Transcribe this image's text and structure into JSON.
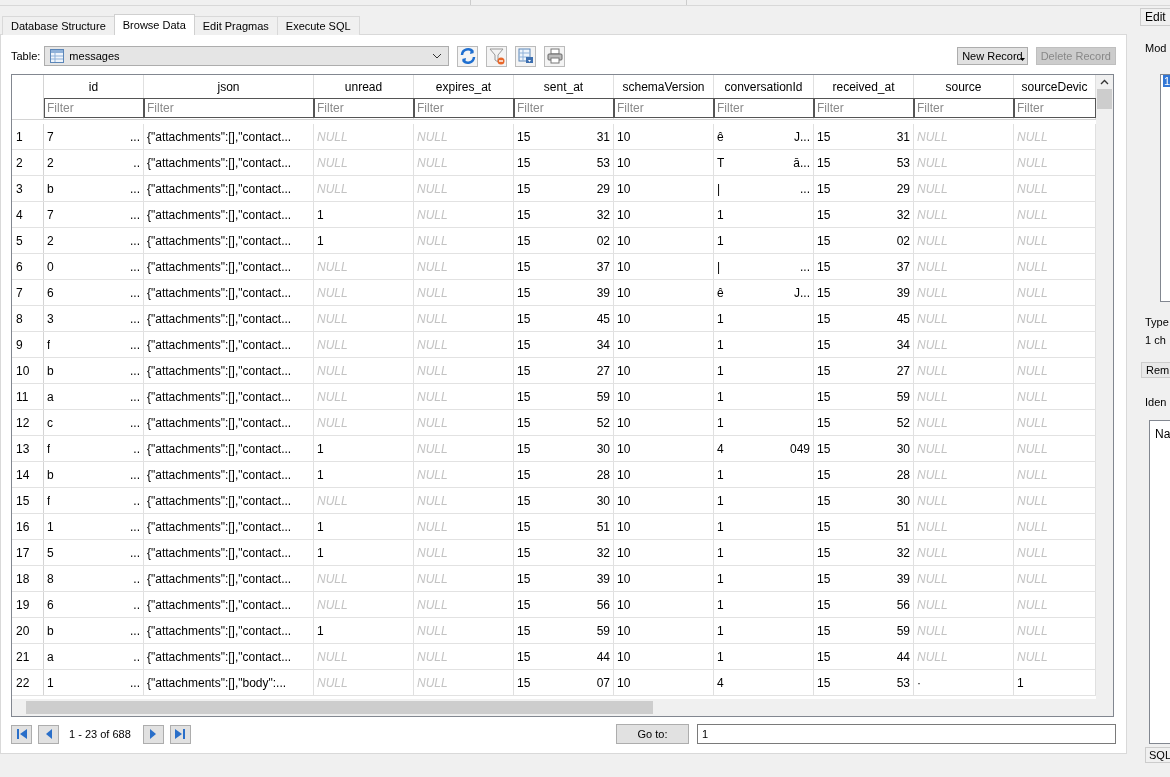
{
  "tabs": [
    {
      "label": "Database Structure",
      "selected": false
    },
    {
      "label": "Browse Data",
      "selected": true
    },
    {
      "label": "Edit Pragmas",
      "selected": false
    },
    {
      "label": "Execute SQL",
      "selected": false
    }
  ],
  "table_picker": {
    "label": "Table:",
    "value": "messages"
  },
  "toolbar": {
    "new_record": {
      "label": "New Record",
      "disabled": false
    },
    "delete_record": {
      "label": "Delete Record",
      "disabled": true
    }
  },
  "table": {
    "columns": [
      {
        "label": "id",
        "filter_placeholder": "Filter"
      },
      {
        "label": "json",
        "filter_placeholder": "Filter"
      },
      {
        "label": "unread",
        "filter_placeholder": "Filter"
      },
      {
        "label": "expires_at",
        "filter_placeholder": "Filter"
      },
      {
        "label": "sent_at",
        "filter_placeholder": "Filter"
      },
      {
        "label": "schemaVersion",
        "filter_placeholder": "Filter"
      },
      {
        "label": "conversationId",
        "filter_placeholder": "Filter"
      },
      {
        "label": "received_at",
        "filter_placeholder": "Filter"
      },
      {
        "label": "source",
        "filter_placeholder": "Filter"
      },
      {
        "label": "sourceDevic",
        "filter_placeholder": "Filter"
      }
    ],
    "rows": [
      {
        "n": "1",
        "cells": [
          {
            "head": "7",
            "tail": "..."
          },
          {
            "head": "{\"attachments\":[],\"contact..."
          },
          {
            "head": "NULL"
          },
          {
            "head": "NULL"
          },
          {
            "head": "15",
            "tail": "31"
          },
          {
            "head": "10"
          },
          {
            "head": "ê",
            "tail": "J..."
          },
          {
            "head": "15",
            "tail": "31"
          },
          {
            "head": "NULL"
          },
          {
            "head": "NULL"
          }
        ]
      },
      {
        "n": "2",
        "cells": [
          {
            "head": "2",
            "tail": ".."
          },
          {
            "head": "{\"attachments\":[],\"contact..."
          },
          {
            "head": "NULL"
          },
          {
            "head": "NULL"
          },
          {
            "head": "15",
            "tail": "53"
          },
          {
            "head": "10"
          },
          {
            "head": "T",
            "tail": "ā..."
          },
          {
            "head": "15",
            "tail": "53"
          },
          {
            "head": "NULL"
          },
          {
            "head": "NULL"
          }
        ]
      },
      {
        "n": "3",
        "cells": [
          {
            "head": "b",
            "tail": "..."
          },
          {
            "head": "{\"attachments\":[],\"contact..."
          },
          {
            "head": "NULL"
          },
          {
            "head": "NULL"
          },
          {
            "head": "15",
            "tail": "29"
          },
          {
            "head": "10"
          },
          {
            "head": "|",
            "tail": "..."
          },
          {
            "head": "15",
            "tail": "29"
          },
          {
            "head": "NULL"
          },
          {
            "head": "NULL"
          }
        ]
      },
      {
        "n": "4",
        "cells": [
          {
            "head": "7",
            "tail": "..."
          },
          {
            "head": "{\"attachments\":[],\"contact..."
          },
          {
            "head": "1"
          },
          {
            "head": "NULL"
          },
          {
            "head": "15",
            "tail": "32"
          },
          {
            "head": "10"
          },
          {
            "head": "1"
          },
          {
            "head": "15",
            "tail": "32"
          },
          {
            "head": "NULL"
          },
          {
            "head": "NULL"
          }
        ]
      },
      {
        "n": "5",
        "cells": [
          {
            "head": "2",
            "tail": "..."
          },
          {
            "head": "{\"attachments\":[],\"contact..."
          },
          {
            "head": "1"
          },
          {
            "head": "NULL"
          },
          {
            "head": "15",
            "tail": "02"
          },
          {
            "head": "10"
          },
          {
            "head": "1"
          },
          {
            "head": "15",
            "tail": "02"
          },
          {
            "head": "NULL"
          },
          {
            "head": "NULL"
          }
        ]
      },
      {
        "n": "6",
        "cells": [
          {
            "head": "0",
            "tail": "..."
          },
          {
            "head": "{\"attachments\":[],\"contact..."
          },
          {
            "head": "NULL"
          },
          {
            "head": "NULL"
          },
          {
            "head": "15",
            "tail": "37"
          },
          {
            "head": "10"
          },
          {
            "head": "|",
            "tail": "..."
          },
          {
            "head": "15",
            "tail": "37"
          },
          {
            "head": "NULL"
          },
          {
            "head": "NULL"
          }
        ]
      },
      {
        "n": "7",
        "cells": [
          {
            "head": "6",
            "tail": "..."
          },
          {
            "head": "{\"attachments\":[],\"contact..."
          },
          {
            "head": "NULL"
          },
          {
            "head": "NULL"
          },
          {
            "head": "15",
            "tail": "39"
          },
          {
            "head": "10"
          },
          {
            "head": "ê",
            "tail": "J..."
          },
          {
            "head": "15",
            "tail": "39"
          },
          {
            "head": "NULL"
          },
          {
            "head": "NULL"
          }
        ]
      },
      {
        "n": "8",
        "cells": [
          {
            "head": "3",
            "tail": "..."
          },
          {
            "head": "{\"attachments\":[],\"contact..."
          },
          {
            "head": "NULL"
          },
          {
            "head": "NULL"
          },
          {
            "head": "15",
            "tail": "45"
          },
          {
            "head": "10"
          },
          {
            "head": "1"
          },
          {
            "head": "15",
            "tail": "45"
          },
          {
            "head": "NULL"
          },
          {
            "head": "NULL"
          }
        ]
      },
      {
        "n": "9",
        "cells": [
          {
            "head": "f",
            "tail": "..."
          },
          {
            "head": "{\"attachments\":[],\"contact..."
          },
          {
            "head": "NULL"
          },
          {
            "head": "NULL"
          },
          {
            "head": "15",
            "tail": "34"
          },
          {
            "head": "10"
          },
          {
            "head": "1"
          },
          {
            "head": "15",
            "tail": "34"
          },
          {
            "head": "NULL"
          },
          {
            "head": "NULL"
          }
        ]
      },
      {
        "n": "10",
        "cells": [
          {
            "head": "b",
            "tail": "..."
          },
          {
            "head": "{\"attachments\":[],\"contact..."
          },
          {
            "head": "NULL"
          },
          {
            "head": "NULL"
          },
          {
            "head": "15",
            "tail": "27"
          },
          {
            "head": "10"
          },
          {
            "head": "1"
          },
          {
            "head": "15",
            "tail": "27"
          },
          {
            "head": "NULL"
          },
          {
            "head": "NULL"
          }
        ]
      },
      {
        "n": "11",
        "cells": [
          {
            "head": "a",
            "tail": "..."
          },
          {
            "head": "{\"attachments\":[],\"contact..."
          },
          {
            "head": "NULL"
          },
          {
            "head": "NULL"
          },
          {
            "head": "15",
            "tail": "59"
          },
          {
            "head": "10"
          },
          {
            "head": "1"
          },
          {
            "head": "15",
            "tail": "59"
          },
          {
            "head": "NULL"
          },
          {
            "head": "NULL"
          }
        ]
      },
      {
        "n": "12",
        "cells": [
          {
            "head": "c",
            "tail": "..."
          },
          {
            "head": "{\"attachments\":[],\"contact..."
          },
          {
            "head": "NULL"
          },
          {
            "head": "NULL"
          },
          {
            "head": "15",
            "tail": "52"
          },
          {
            "head": "10"
          },
          {
            "head": "1"
          },
          {
            "head": "15",
            "tail": "52"
          },
          {
            "head": "NULL"
          },
          {
            "head": "NULL"
          }
        ]
      },
      {
        "n": "13",
        "cells": [
          {
            "head": "f",
            "tail": ".."
          },
          {
            "head": "{\"attachments\":[],\"contact..."
          },
          {
            "head": "1"
          },
          {
            "head": "NULL"
          },
          {
            "head": "15",
            "tail": "30"
          },
          {
            "head": "10"
          },
          {
            "head": "4",
            "tail": "049"
          },
          {
            "head": "15",
            "tail": "30"
          },
          {
            "head": "NULL"
          },
          {
            "head": "NULL"
          }
        ]
      },
      {
        "n": "14",
        "cells": [
          {
            "head": "b",
            "tail": "..."
          },
          {
            "head": "{\"attachments\":[],\"contact..."
          },
          {
            "head": "1"
          },
          {
            "head": "NULL"
          },
          {
            "head": "15",
            "tail": "28"
          },
          {
            "head": "10"
          },
          {
            "head": "1"
          },
          {
            "head": "15",
            "tail": "28"
          },
          {
            "head": "NULL"
          },
          {
            "head": "NULL"
          }
        ]
      },
      {
        "n": "15",
        "cells": [
          {
            "head": "f",
            "tail": ".."
          },
          {
            "head": "{\"attachments\":[],\"contact..."
          },
          {
            "head": "NULL"
          },
          {
            "head": "NULL"
          },
          {
            "head": "15",
            "tail": "30"
          },
          {
            "head": "10"
          },
          {
            "head": "1"
          },
          {
            "head": "15",
            "tail": "30"
          },
          {
            "head": "NULL"
          },
          {
            "head": "NULL"
          }
        ]
      },
      {
        "n": "16",
        "cells": [
          {
            "head": "1",
            "tail": "..."
          },
          {
            "head": "{\"attachments\":[],\"contact..."
          },
          {
            "head": "1"
          },
          {
            "head": "NULL"
          },
          {
            "head": "15",
            "tail": "51"
          },
          {
            "head": "10"
          },
          {
            "head": "1"
          },
          {
            "head": "15",
            "tail": "51"
          },
          {
            "head": "NULL"
          },
          {
            "head": "NULL"
          }
        ]
      },
      {
        "n": "17",
        "cells": [
          {
            "head": "5",
            "tail": "..."
          },
          {
            "head": "{\"attachments\":[],\"contact..."
          },
          {
            "head": "1"
          },
          {
            "head": "NULL"
          },
          {
            "head": "15",
            "tail": "32"
          },
          {
            "head": "10"
          },
          {
            "head": "1"
          },
          {
            "head": "15",
            "tail": "32"
          },
          {
            "head": "NULL"
          },
          {
            "head": "NULL"
          }
        ]
      },
      {
        "n": "18",
        "cells": [
          {
            "head": "8",
            "tail": ".."
          },
          {
            "head": "{\"attachments\":[],\"contact..."
          },
          {
            "head": "NULL"
          },
          {
            "head": "NULL"
          },
          {
            "head": "15",
            "tail": "39"
          },
          {
            "head": "10"
          },
          {
            "head": "1"
          },
          {
            "head": "15",
            "tail": "39"
          },
          {
            "head": "NULL"
          },
          {
            "head": "NULL"
          }
        ]
      },
      {
        "n": "19",
        "cells": [
          {
            "head": "6",
            "tail": ".."
          },
          {
            "head": "{\"attachments\":[],\"contact..."
          },
          {
            "head": "NULL"
          },
          {
            "head": "NULL"
          },
          {
            "head": "15",
            "tail": "56"
          },
          {
            "head": "10"
          },
          {
            "head": "1"
          },
          {
            "head": "15",
            "tail": "56"
          },
          {
            "head": "NULL"
          },
          {
            "head": "NULL"
          }
        ]
      },
      {
        "n": "20",
        "cells": [
          {
            "head": "b",
            "tail": "..."
          },
          {
            "head": "{\"attachments\":[],\"contact..."
          },
          {
            "head": "1"
          },
          {
            "head": "NULL"
          },
          {
            "head": "15",
            "tail": "59"
          },
          {
            "head": "10"
          },
          {
            "head": "1"
          },
          {
            "head": "15",
            "tail": "59"
          },
          {
            "head": "NULL"
          },
          {
            "head": "NULL"
          }
        ]
      },
      {
        "n": "21",
        "cells": [
          {
            "head": "a",
            "tail": ".."
          },
          {
            "head": "{\"attachments\":[],\"contact..."
          },
          {
            "head": "NULL"
          },
          {
            "head": "NULL"
          },
          {
            "head": "15",
            "tail": "44"
          },
          {
            "head": "10"
          },
          {
            "head": "1"
          },
          {
            "head": "15",
            "tail": "44"
          },
          {
            "head": "NULL"
          },
          {
            "head": "NULL"
          }
        ]
      },
      {
        "n": "22",
        "cells": [
          {
            "head": "1",
            "tail": "..."
          },
          {
            "head": "{\"attachments\":[],\"body\":..."
          },
          {
            "head": "NULL"
          },
          {
            "head": "NULL"
          },
          {
            "head": "15",
            "tail": "07"
          },
          {
            "head": "10"
          },
          {
            "head": "4"
          },
          {
            "head": "15",
            "tail": "53"
          },
          {
            "head": "·"
          },
          {
            "head": "1"
          }
        ]
      }
    ]
  },
  "pager": {
    "range": "1 - 23 of 688",
    "goto_label": "Go to:",
    "goto_value": "1"
  },
  "side": {
    "tab": "Edit",
    "mode_label": "Mod",
    "selected_value": "1",
    "type_label": "Type",
    "type_value": "1 ch",
    "remove_button": "Rem",
    "identity_label": "Iden",
    "name_header": "Na",
    "bottom_tab": "SQL"
  }
}
